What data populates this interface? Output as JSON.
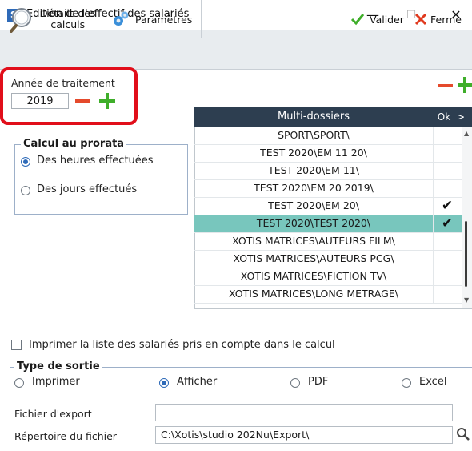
{
  "window": {
    "icon_letter": "S",
    "title": "Edition de l'effectif des salariés",
    "minimize": "—",
    "maximize": "☐",
    "close": "✕"
  },
  "toolbar": {
    "details_line1": "Détails des",
    "details_line2": "calculs",
    "params": "Paramètres",
    "valider": "Valider",
    "fermer": "Ferme"
  },
  "year": {
    "label": "Année de traitement",
    "value": "2019"
  },
  "prorata": {
    "title": "Calcul au prorata",
    "option_hours": "Des heures effectuées",
    "option_days": "Des jours effectués",
    "selected": "hours"
  },
  "grid": {
    "header_name": "Multi-dossiers",
    "header_ok": "Ok",
    "header_more": ">",
    "rows": [
      {
        "name": "SPORT\\SPORT\\",
        "ok": ""
      },
      {
        "name": "TEST 2020\\EM 11 20\\",
        "ok": ""
      },
      {
        "name": "TEST 2020\\EM 11\\",
        "ok": ""
      },
      {
        "name": "TEST 2020\\EM 20 2019\\",
        "ok": ""
      },
      {
        "name": "TEST 2020\\EM 20\\",
        "ok": "✔"
      },
      {
        "name": "TEST 2020\\TEST 2020\\",
        "ok": "✔"
      },
      {
        "name": "XOTIS MATRICES\\AUTEURS FILM\\",
        "ok": ""
      },
      {
        "name": "XOTIS MATRICES\\AUTEURS PCG\\",
        "ok": ""
      },
      {
        "name": "XOTIS MATRICES\\FICTION TV\\",
        "ok": ""
      },
      {
        "name": "XOTIS MATRICES\\LONG METRAGE\\",
        "ok": ""
      }
    ],
    "selected_row": 5
  },
  "print_list": {
    "label": "Imprimer la liste des salariés pris en compte dans le calcul",
    "checked": false
  },
  "sortie": {
    "title": "Type de sortie",
    "options": [
      "Imprimer",
      "Afficher",
      "PDF",
      "Excel"
    ],
    "selected": "Afficher"
  },
  "export": {
    "file_label": "Fichier d'export",
    "file_value": "",
    "dir_label": "Répertoire du fichier",
    "dir_value": "C:\\Xotis\\studio 202Nu\\Export\\"
  },
  "colors": {
    "accent": "#2e6ab8",
    "grid_header": "#2d3e50",
    "selected_row": "#78c6bd",
    "minus": "#e54a2c",
    "plus": "#3fae2a",
    "highlight": "#e10e1a"
  }
}
